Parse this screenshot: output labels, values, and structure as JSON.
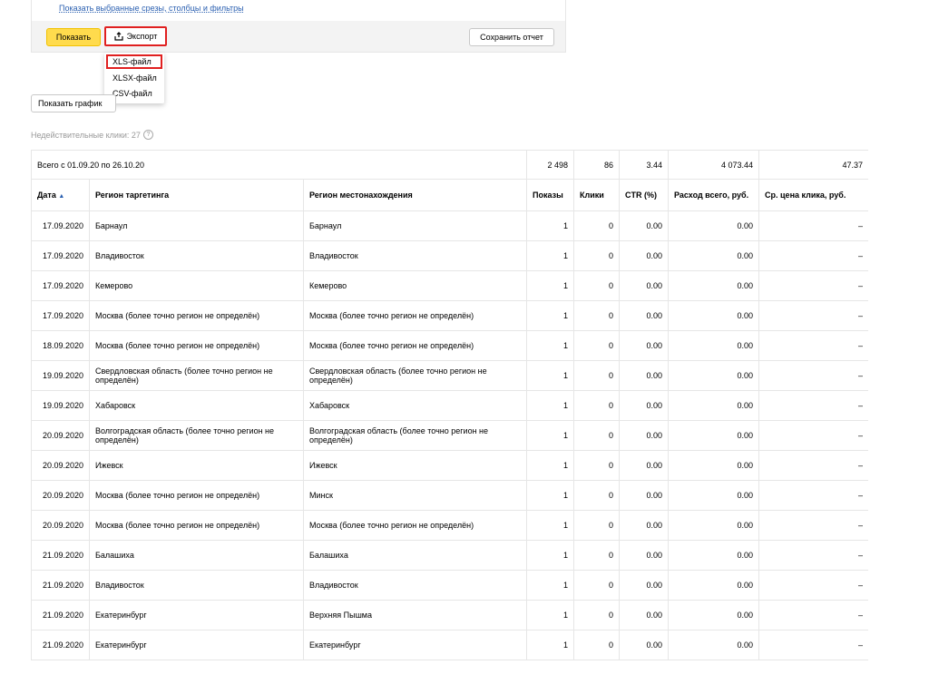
{
  "top_link": "Показать выбранные срезы, столбцы и фильтры",
  "toolbar": {
    "show_label": "Показать",
    "export_label": "Экспорт",
    "save_label": "Сохранить отчет"
  },
  "export_menu": [
    {
      "label": "XLS-файл",
      "highlighted": true
    },
    {
      "label": "XLSX-файл"
    },
    {
      "label": "CSV-файл"
    }
  ],
  "show_graph_label": "Показать график",
  "invalid_clicks": "Недействительные клики: 27",
  "colors": {
    "accent_yellow": "#ffdb4d",
    "highlight_red": "#e02020",
    "link_blue": "#2a5fb0"
  },
  "table": {
    "total": {
      "label": "Всего с 01.09.20 по 26.10.20",
      "impressions": "2 498",
      "clicks": "86",
      "ctr": "3.44",
      "spend": "4 073.44",
      "avg_cpc": "47.37"
    },
    "headers": {
      "date": "Дата",
      "sort_indicator": "▲",
      "target_region": "Регион таргетинга",
      "location_region": "Регион местонахождения",
      "impressions": "Показы",
      "clicks": "Клики",
      "ctr": "CTR (%)",
      "spend": "Расход всего, руб.",
      "avg_cpc": "Ср. цена клика, руб."
    },
    "rows": [
      {
        "date": "17.09.2020",
        "target": "Барнаул",
        "location": "Барнаул",
        "impressions": "1",
        "clicks": "0",
        "ctr": "0.00",
        "spend": "0.00",
        "avg_cpc": "–"
      },
      {
        "date": "17.09.2020",
        "target": "Владивосток",
        "location": "Владивосток",
        "impressions": "1",
        "clicks": "0",
        "ctr": "0.00",
        "spend": "0.00",
        "avg_cpc": "–"
      },
      {
        "date": "17.09.2020",
        "target": "Кемерово",
        "location": "Кемерово",
        "impressions": "1",
        "clicks": "0",
        "ctr": "0.00",
        "spend": "0.00",
        "avg_cpc": "–"
      },
      {
        "date": "17.09.2020",
        "target": "Москва (более точно регион не определён)",
        "location": "Москва (более точно регион не определён)",
        "impressions": "1",
        "clicks": "0",
        "ctr": "0.00",
        "spend": "0.00",
        "avg_cpc": "–"
      },
      {
        "date": "18.09.2020",
        "target": "Москва (более точно регион не определён)",
        "location": "Москва (более точно регион не определён)",
        "impressions": "1",
        "clicks": "0",
        "ctr": "0.00",
        "spend": "0.00",
        "avg_cpc": "–"
      },
      {
        "date": "19.09.2020",
        "target": "Свердловская область (более точно регион не определён)",
        "location": "Свердловская область (более точно регион не определён)",
        "impressions": "1",
        "clicks": "0",
        "ctr": "0.00",
        "spend": "0.00",
        "avg_cpc": "–"
      },
      {
        "date": "19.09.2020",
        "target": "Хабаровск",
        "location": "Хабаровск",
        "impressions": "1",
        "clicks": "0",
        "ctr": "0.00",
        "spend": "0.00",
        "avg_cpc": "–"
      },
      {
        "date": "20.09.2020",
        "target": "Волгоградская область (более точно регион не определён)",
        "location": "Волгоградская область (более точно регион не определён)",
        "impressions": "1",
        "clicks": "0",
        "ctr": "0.00",
        "spend": "0.00",
        "avg_cpc": "–"
      },
      {
        "date": "20.09.2020",
        "target": "Ижевск",
        "location": "Ижевск",
        "impressions": "1",
        "clicks": "0",
        "ctr": "0.00",
        "spend": "0.00",
        "avg_cpc": "–"
      },
      {
        "date": "20.09.2020",
        "target": "Москва (более точно регион не определён)",
        "location": "Минск",
        "impressions": "1",
        "clicks": "0",
        "ctr": "0.00",
        "spend": "0.00",
        "avg_cpc": "–"
      },
      {
        "date": "20.09.2020",
        "target": "Москва (более точно регион не определён)",
        "location": "Москва (более точно регион не определён)",
        "impressions": "1",
        "clicks": "0",
        "ctr": "0.00",
        "spend": "0.00",
        "avg_cpc": "–"
      },
      {
        "date": "21.09.2020",
        "target": "Балашиха",
        "location": "Балашиха",
        "impressions": "1",
        "clicks": "0",
        "ctr": "0.00",
        "spend": "0.00",
        "avg_cpc": "–"
      },
      {
        "date": "21.09.2020",
        "target": "Владивосток",
        "location": "Владивосток",
        "impressions": "1",
        "clicks": "0",
        "ctr": "0.00",
        "spend": "0.00",
        "avg_cpc": "–"
      },
      {
        "date": "21.09.2020",
        "target": "Екатеринбург",
        "location": "Верхняя Пышма",
        "impressions": "1",
        "clicks": "0",
        "ctr": "0.00",
        "spend": "0.00",
        "avg_cpc": "–"
      },
      {
        "date": "21.09.2020",
        "target": "Екатеринбург",
        "location": "Екатеринбург",
        "impressions": "1",
        "clicks": "0",
        "ctr": "0.00",
        "spend": "0.00",
        "avg_cpc": "–"
      }
    ]
  }
}
